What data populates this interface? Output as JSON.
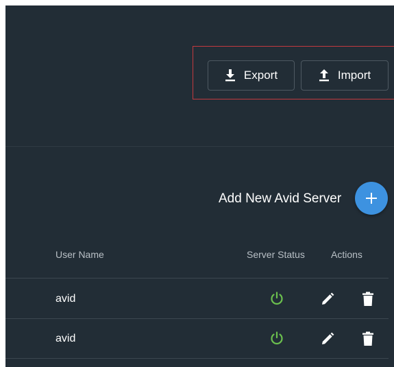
{
  "toolbar": {
    "export_label": "Export",
    "import_label": "Import"
  },
  "servers": {
    "add_label": "Add New Avid Server",
    "columns": {
      "user_name": "User Name",
      "server_status": "Server Status",
      "actions": "Actions"
    },
    "rows": [
      {
        "user_name": "avid",
        "status_icon": "power-icon",
        "status_color": "#6bbf4e"
      },
      {
        "user_name": "avid",
        "status_icon": "power-icon",
        "status_color": "#6bbf4e"
      }
    ]
  },
  "colors": {
    "background": "#222d36",
    "accent": "#3d92e0",
    "highlight_border": "#c43a3f",
    "status_on": "#6bbf4e"
  }
}
